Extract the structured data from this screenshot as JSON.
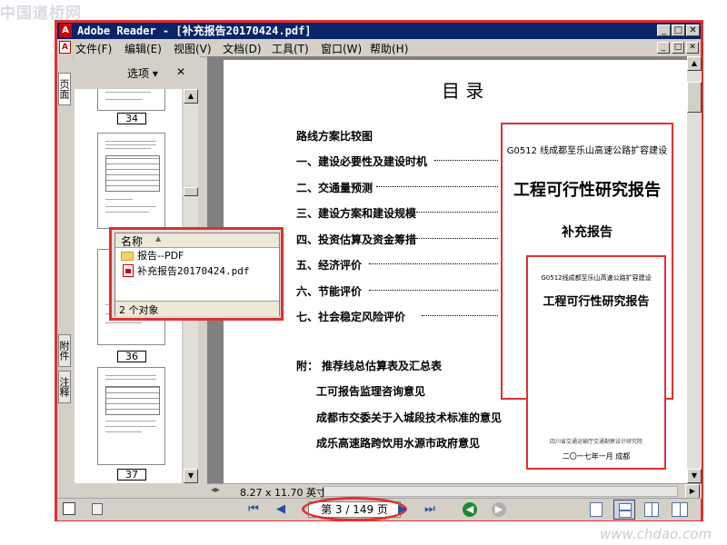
{
  "watermark": {
    "top_left": "中国道桥网",
    "bottom_right": "www.chdao.com"
  },
  "window": {
    "title": "Adobe Reader - [补充报告20170424.pdf]",
    "min": "_",
    "max": "□",
    "close": "✕"
  },
  "menu": {
    "items": [
      "文件(F)",
      "编辑(E)",
      "视图(V)",
      "文档(D)",
      "工具(T)",
      "窗口(W)",
      "帮助(H)"
    ]
  },
  "side_tabs": {
    "pages": "页面",
    "attachments": "附件",
    "comments": "注释"
  },
  "nav_panel": {
    "options_label": "选项",
    "options_caret": "▾",
    "close": "✕",
    "page_labels": [
      "34",
      "36",
      "37"
    ]
  },
  "explorer": {
    "column_name": "名称",
    "sort_caret": "▲",
    "items": [
      {
        "name": "报告--PDF",
        "type": "folder"
      },
      {
        "name": "补充报告20170424.pdf",
        "type": "pdf"
      }
    ],
    "status": "2 个对象"
  },
  "document": {
    "toc_title": "目  录",
    "toc_items": [
      "路线方案比较图",
      "一、建设必要性及建设时机",
      "二、交通量预测",
      "三、建设方案和建设规模",
      "四、投资估算及资金筹措",
      "五、经济评价",
      "六、节能评价",
      "七、社会稳定风险评价"
    ],
    "appendix_label": "附：",
    "appendix_items": [
      "推荐线总估算表及汇总表",
      "工可报告监理咨询意见",
      "成都市交委关于入城段技术标准的意见",
      "成乐高速路跨饮用水源市政府意见"
    ],
    "cover_large": {
      "project": "G0512 线成都至乐山高速公路扩容建设",
      "title": "工程可行性研究报告",
      "subtitle": "补充报告"
    },
    "cover_small": {
      "project": "G0512线成都至乐山高速公路扩容建设",
      "title": "工程可行性研究报告",
      "footer_org": "四川省交通运输厅交通勘察设计研究院",
      "date": "二〇一七年一月  成都"
    }
  },
  "statusbar": {
    "page_size": "8.27 x 11.70 英寸",
    "page_indicator": "第 3 / 149 页"
  },
  "colors": {
    "titlebar": "#0a246a",
    "highlight": "#e03030",
    "chrome": "#d4d0c8",
    "nav_arrow": "#2050a0",
    "go_green": "#1a8a30"
  }
}
